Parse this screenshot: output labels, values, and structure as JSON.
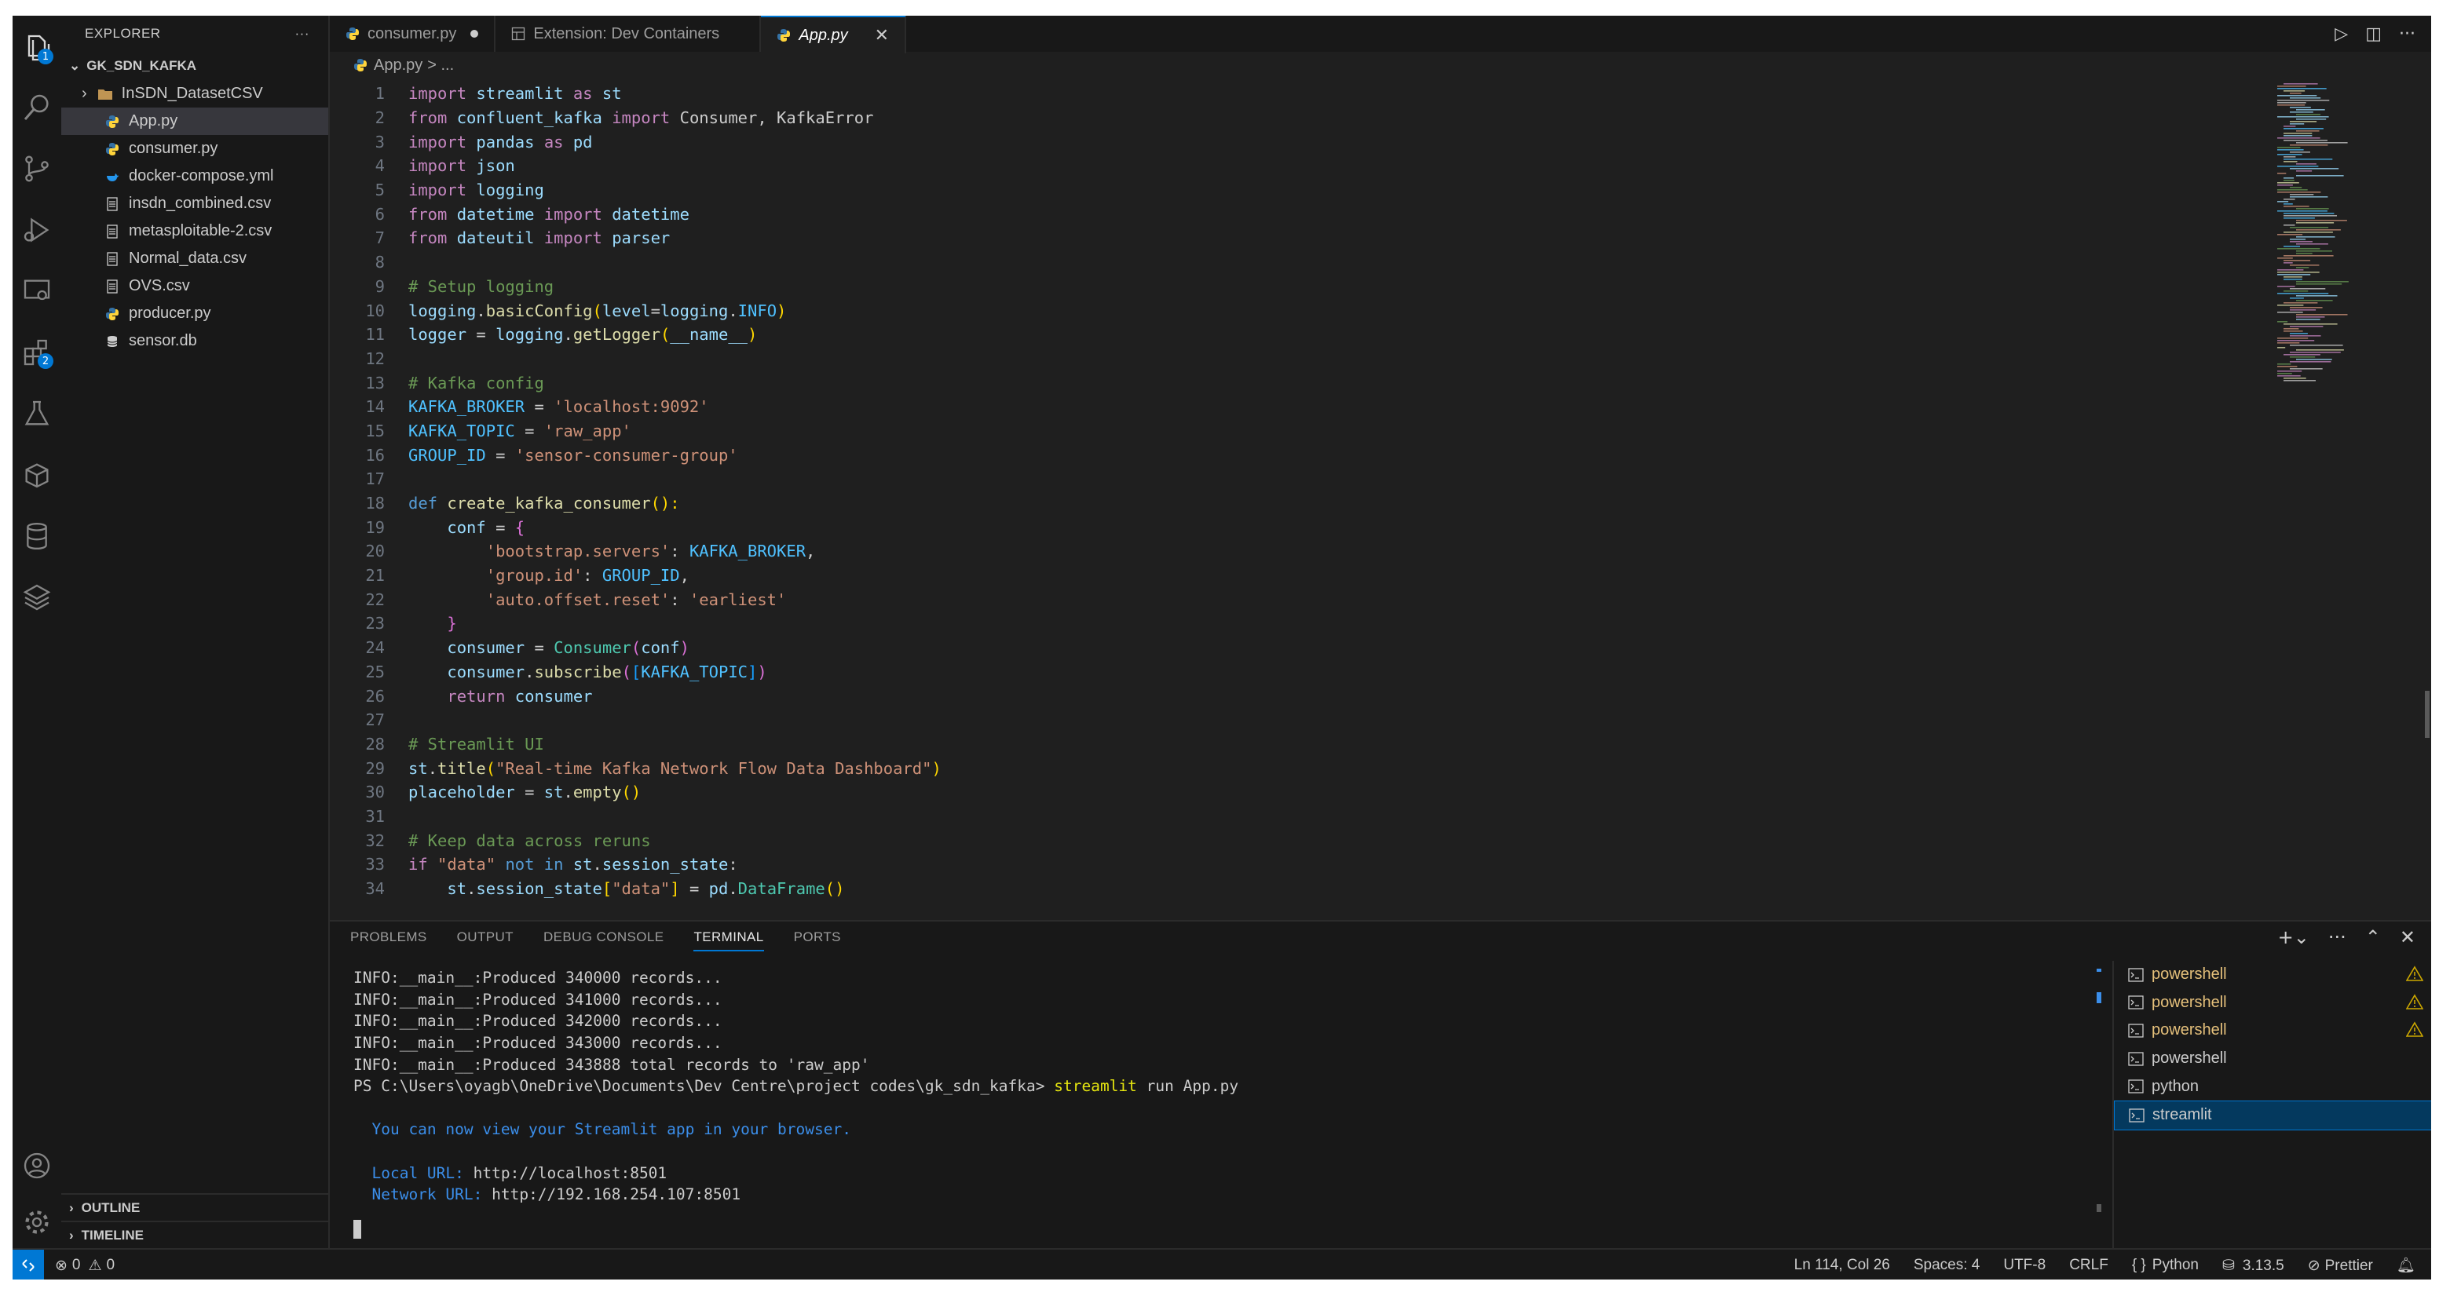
{
  "explorer": {
    "title": "EXPLORER",
    "more": "···",
    "root": "GK_SDN_KAFKA",
    "items": [
      {
        "label": "InSDN_DatasetCSV",
        "type": "folder"
      },
      {
        "label": "App.py",
        "type": "python"
      },
      {
        "label": "consumer.py",
        "type": "python"
      },
      {
        "label": "docker-compose.yml",
        "type": "docker"
      },
      {
        "label": "insdn_combined.csv",
        "type": "csv"
      },
      {
        "label": "metasploitable-2.csv",
        "type": "csv"
      },
      {
        "label": "Normal_data.csv",
        "type": "csv"
      },
      {
        "label": "OVS.csv",
        "type": "csv"
      },
      {
        "label": "producer.py",
        "type": "python"
      },
      {
        "label": "sensor.db",
        "type": "db"
      }
    ],
    "outline": "OUTLINE",
    "timeline": "TIMELINE"
  },
  "activity_badges": {
    "explorer": "1",
    "extensions": "2"
  },
  "tabs": [
    {
      "label": "consumer.py",
      "modified": true
    },
    {
      "label": "Extension: Dev Containers"
    },
    {
      "label": "App.py",
      "active": true
    }
  ],
  "breadcrumb": {
    "file": "App.py",
    "rest": "> ..."
  },
  "code_lines": [
    "1",
    "2",
    "3",
    "4",
    "5",
    "6",
    "7",
    "8",
    "9",
    "10",
    "11",
    "12",
    "13",
    "14",
    "15",
    "16",
    "17",
    "18",
    "19",
    "20",
    "21",
    "22",
    "23",
    "24",
    "25",
    "26",
    "27",
    "28",
    "29",
    "30",
    "31",
    "32",
    "33",
    "34"
  ],
  "code": {
    "l1": [
      "import",
      " streamlit ",
      "as",
      " st"
    ],
    "l2": [
      "from",
      " confluent_kafka ",
      "import",
      " Consumer, KafkaError"
    ],
    "l3": [
      "import",
      " pandas ",
      "as",
      " pd"
    ],
    "l4": [
      "import",
      " json"
    ],
    "l5": [
      "import",
      " logging"
    ],
    "l6": [
      "from",
      " datetime ",
      "import",
      " datetime"
    ],
    "l7": [
      "from",
      " dateutil ",
      "import",
      " parser"
    ],
    "l9": "# Setup logging",
    "l10": [
      "logging",
      ".",
      "basicConfig",
      "(",
      "level",
      "=",
      "logging",
      ".",
      "INFO",
      ")"
    ],
    "l11": [
      "logger",
      " = ",
      "logging",
      ".",
      "getLogger",
      "(",
      "__name__",
      ")"
    ],
    "l13": "# Kafka config",
    "l14": [
      "KAFKA_BROKER",
      " = ",
      "'localhost:9092'"
    ],
    "l15": [
      "KAFKA_TOPIC",
      " = ",
      "'raw_app'"
    ],
    "l16": [
      "GROUP_ID",
      " = ",
      "'sensor-consumer-group'"
    ],
    "l18": [
      "def",
      " ",
      "create_kafka_consumer",
      "():"
    ],
    "l19": [
      "    ",
      "conf",
      " = ",
      "{"
    ],
    "l20": [
      "        ",
      "'bootstrap.servers'",
      ": ",
      "KAFKA_BROKER",
      ","
    ],
    "l21": [
      "        ",
      "'group.id'",
      ": ",
      "GROUP_ID",
      ","
    ],
    "l22": [
      "        ",
      "'auto.offset.reset'",
      ": ",
      "'earliest'"
    ],
    "l23": [
      "    ",
      "}"
    ],
    "l24": [
      "    ",
      "consumer",
      " = ",
      "Consumer",
      "(",
      "conf",
      ")"
    ],
    "l25": [
      "    ",
      "consumer",
      ".",
      "subscribe",
      "(",
      "[",
      "KAFKA_TOPIC",
      "]",
      ")"
    ],
    "l26": [
      "    ",
      "return",
      " ",
      "consumer"
    ],
    "l28": "# Streamlit UI",
    "l29": [
      "st",
      ".",
      "title",
      "(",
      "\"Real-time Kafka Network Flow Data Dashboard\"",
      ")"
    ],
    "l30": [
      "placeholder",
      " = ",
      "st",
      ".",
      "empty",
      "()"
    ],
    "l32": "# Keep data across reruns",
    "l33": [
      "if",
      " ",
      "\"data\"",
      " ",
      "not in",
      " ",
      "st",
      ".",
      "session_state",
      ":"
    ],
    "l34": [
      "    ",
      "st",
      ".",
      "session_state",
      "[",
      "\"data\"",
      "]",
      " = ",
      "pd",
      ".",
      "DataFrame",
      "()"
    ]
  },
  "panel": {
    "tabs": [
      "PROBLEMS",
      "OUTPUT",
      "DEBUG CONSOLE",
      "TERMINAL",
      "PORTS"
    ],
    "active_tab": "TERMINAL",
    "terminal_lines": [
      "INFO:__main__:Produced 340000 records...",
      "INFO:__main__:Produced 341000 records...",
      "INFO:__main__:Produced 342000 records...",
      "INFO:__main__:Produced 343000 records...",
      "INFO:__main__:Produced 343888 total records to 'raw_app'"
    ],
    "prompt": "PS C:\\Users\\oyagb\\OneDrive\\Documents\\Dev Centre\\project codes\\gk_sdn_kafka> ",
    "command_name": "streamlit",
    "command_args": " run App.py",
    "view_msg": "  You can now view your Streamlit app in your browser.",
    "local_label": "  Local URL: ",
    "local_url": "http://localhost:8501",
    "network_label": "  Network URL: ",
    "network_url": "http://192.168.254.107:8501",
    "terminals": [
      {
        "label": "powershell",
        "warn": true
      },
      {
        "label": "powershell",
        "warn": true
      },
      {
        "label": "powershell",
        "warn": true
      },
      {
        "label": "powershell",
        "warn": false
      },
      {
        "label": "python",
        "warn": false
      },
      {
        "label": "streamlit",
        "warn": false,
        "selected": true
      }
    ]
  },
  "status": {
    "errors": "0",
    "warnings": "0",
    "position": "Ln 114, Col 26",
    "spaces": "Spaces: 4",
    "encoding": "UTF-8",
    "eol": "CRLF",
    "language": "Python",
    "version": "3.13.5",
    "formatter": "Prettier",
    "brace_icon": "{ }"
  },
  "colors": {
    "accent": "#0078d4",
    "editor_bg": "#1f1f1f",
    "sidebar_bg": "#181818"
  }
}
